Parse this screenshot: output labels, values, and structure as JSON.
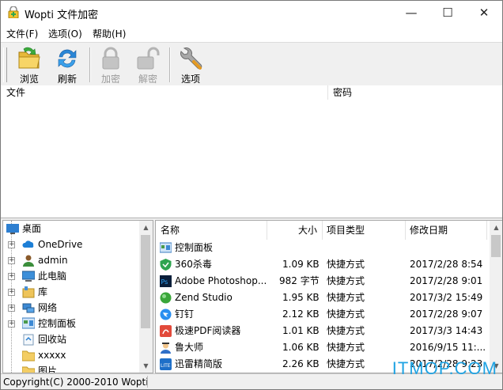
{
  "window": {
    "title": "Wopti 文件加密",
    "controls": {
      "minimize": "—",
      "maximize": "☐",
      "close": "✕"
    }
  },
  "menu": [
    {
      "label": "文件(F)"
    },
    {
      "label": "选项(O)"
    },
    {
      "label": "帮助(H)"
    }
  ],
  "toolbar": {
    "browse": "浏览",
    "refresh": "刷新",
    "encrypt": "加密",
    "decrypt": "解密",
    "options": "选项"
  },
  "file_list": {
    "columns": [
      "文件",
      "密码"
    ]
  },
  "tree": {
    "items": [
      {
        "label": "桌面",
        "icon": "desktop-icon"
      },
      {
        "label": "OneDrive",
        "icon": "cloud-icon"
      },
      {
        "label": "admin",
        "icon": "user-icon"
      },
      {
        "label": "此电脑",
        "icon": "computer-icon"
      },
      {
        "label": "库",
        "icon": "library-icon"
      },
      {
        "label": "网络",
        "icon": "network-icon"
      },
      {
        "label": "控制面板",
        "icon": "control-panel-icon"
      },
      {
        "label": "回收站",
        "icon": "recycle-bin-icon"
      },
      {
        "label": "xxxxx",
        "icon": "folder-icon"
      },
      {
        "label": "图片",
        "icon": "folder-icon"
      }
    ]
  },
  "explorer": {
    "columns": {
      "name": "名称",
      "size": "大小",
      "type": "项目类型",
      "modified": "修改日期"
    },
    "rows": [
      {
        "name": "控制面板",
        "size": "",
        "type": "",
        "modified": "",
        "icon": "control-panel-icon"
      },
      {
        "name": "360杀毒",
        "size": "1.09 KB",
        "type": "快捷方式",
        "modified": "2017/2/28 8:54",
        "icon": "shield-icon"
      },
      {
        "name": "Adobe Photoshop...",
        "size": "982 字节",
        "type": "快捷方式",
        "modified": "2017/2/28 9:01",
        "icon": "photoshop-icon"
      },
      {
        "name": "Zend Studio",
        "size": "1.95 KB",
        "type": "快捷方式",
        "modified": "2017/3/2 15:49",
        "icon": "zend-icon"
      },
      {
        "name": "钉钉",
        "size": "2.12 KB",
        "type": "快捷方式",
        "modified": "2017/2/28 9:07",
        "icon": "dingtalk-icon"
      },
      {
        "name": "极速PDF阅读器",
        "size": "1.01 KB",
        "type": "快捷方式",
        "modified": "2017/3/3 14:43",
        "icon": "pdf-icon"
      },
      {
        "name": "鲁大师",
        "size": "1.06 KB",
        "type": "快捷方式",
        "modified": "2016/9/15 11:...",
        "icon": "ludashi-icon"
      },
      {
        "name": "迅雷精简版",
        "size": "2.26 KB",
        "type": "快捷方式",
        "modified": "2017/2/28 9:23",
        "icon": "xunlei-icon"
      }
    ]
  },
  "status": {
    "copyright": "Copyright(C) 2000-2010 Wopti"
  },
  "watermark": "ITMOP.COM",
  "colors": {
    "accent": "#1fa3e3",
    "selection": "#cce8ff"
  }
}
